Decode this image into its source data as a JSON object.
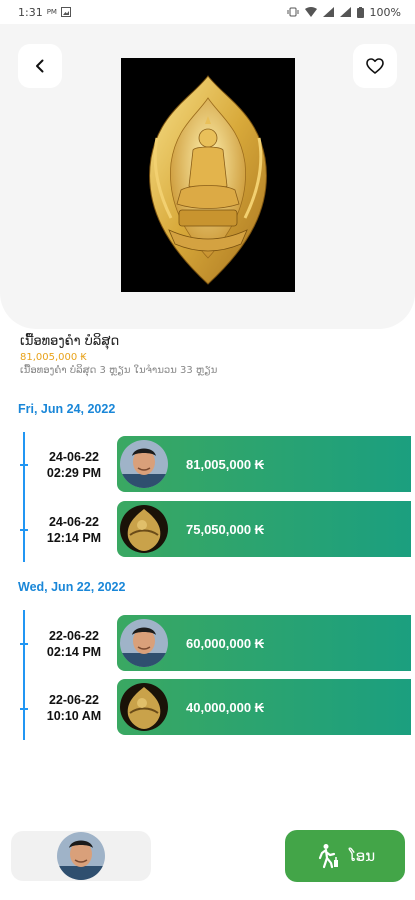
{
  "status": {
    "time": "1:31",
    "ampm": "PM",
    "battery": "100%"
  },
  "product": {
    "title": "ເນື້ອທອງຄຳ ບໍລິສຸດ",
    "price": "81,005,000 ₭",
    "description": "ເນື້ອທອງຄຳ ບໍລິສຸດ 3 ຫຼຽນ ໃນຈຳນວນ 33 ຫຼຽນ"
  },
  "groups": [
    {
      "date": "Fri, Jun 24, 2022",
      "bids": [
        {
          "date": "24-06-22",
          "time": "02:29 PM",
          "amount": "81,005,000 ₭",
          "avatar": "person-avatar"
        },
        {
          "date": "24-06-22",
          "time": "12:14 PM",
          "amount": "75,050,000 ₭",
          "avatar": "amulet-avatar"
        }
      ]
    },
    {
      "date": "Wed, Jun 22, 2022",
      "bids": [
        {
          "date": "22-06-22",
          "time": "02:14 PM",
          "amount": "60,000,000 ₭",
          "avatar": "person-avatar"
        },
        {
          "date": "22-06-22",
          "time": "10:10 AM",
          "amount": "40,000,000 ₭",
          "avatar": "amulet-avatar"
        }
      ]
    }
  ],
  "bottom": {
    "bid_label": "ໂອນ"
  },
  "colors": {
    "accent_blue": "#1a87d8",
    "price_gold": "#e8a21a",
    "card_green_start": "#3aa862",
    "card_green_end": "#1b9f7f",
    "button_green": "#43a548"
  }
}
